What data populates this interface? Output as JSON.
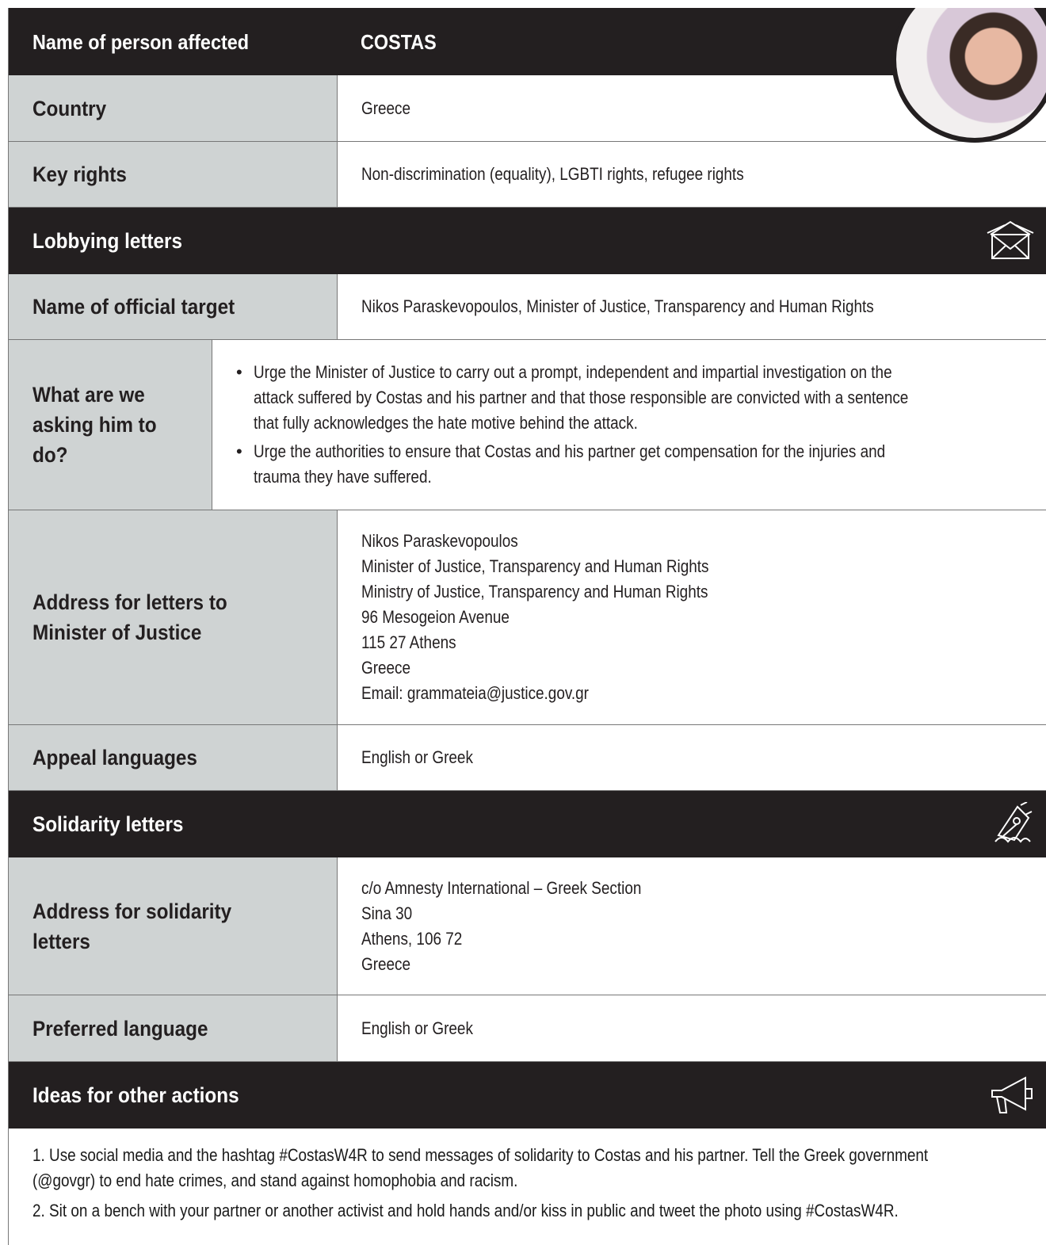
{
  "person": {
    "label": "Name of person affected",
    "value": "COSTAS"
  },
  "country": {
    "label": "Country",
    "value": "Greece"
  },
  "key_rights": {
    "label": "Key rights",
    "value": "Non-discrimination (equality), LGBTI rights, refugee rights"
  },
  "lobbying": {
    "heading": "Lobbying letters",
    "target": {
      "label": "Name of official target",
      "value": "Nikos Paraskevopoulos, Minister of Justice, Transparency and Human Rights"
    },
    "asks": {
      "label": "What are we asking him to do?",
      "items": [
        "Urge the Minister of Justice to carry out a prompt, independent and impartial investigation on the attack suffered by Costas and his partner and that those responsible are convicted with a sentence that fully acknowledges the hate motive behind the attack.",
        "Urge the authorities to ensure that Costas and his partner get compensation for the injuries and trauma they have suffered."
      ]
    },
    "address": {
      "label": "Address for letters to Minister of Justice",
      "lines": [
        "Nikos Paraskevopoulos",
        "Minister of Justice, Transparency and Human Rights",
        "Ministry of Justice, Transparency and Human Rights",
        "96 Mesogeion Avenue",
        "115 27 Athens",
        "Greece",
        "Email: grammateia@justice.gov.gr"
      ]
    },
    "languages": {
      "label": "Appeal languages",
      "value": "English or Greek"
    }
  },
  "solidarity": {
    "heading": "Solidarity letters",
    "address": {
      "label": "Address for solidarity letters",
      "lines": [
        "c/o Amnesty International – Greek Section",
        "Sina 30",
        "Athens, 106 72",
        "Greece"
      ]
    },
    "language": {
      "label": "Preferred language",
      "value": "English or Greek"
    }
  },
  "ideas": {
    "heading": "Ideas for other actions",
    "items": [
      "1. Use social media and the hashtag #CostasW4R to send messages of solidarity to Costas and his partner. Tell the Greek government (@govgr) to end hate crimes, and stand against homophobia and racism.",
      "2. Sit on a bench with your partner or another activist and hold hands and/or kiss in public and tweet the photo using #CostasW4R."
    ]
  },
  "icons": {
    "lobbying": "envelope-icon",
    "solidarity": "pen-nib-icon",
    "ideas": "megaphone-icon"
  }
}
